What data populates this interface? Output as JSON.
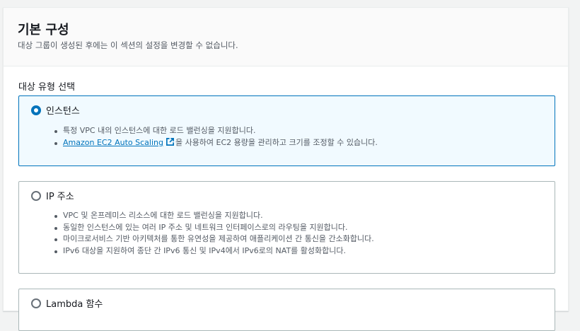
{
  "section": {
    "title": "기본 구성",
    "description": "대상 그룹이 생성된 후에는 이 섹션의 설정을 변경할 수 없습니다."
  },
  "target_type": {
    "label": "대상 유형 선택",
    "options": [
      {
        "label": "인스턴스",
        "selected": true,
        "bullets": [
          "특정 VPC 내의 인스턴스에 대한 로드 밸런싱을 지원합니다."
        ],
        "link_text": "Amazon EC2 Auto Scaling",
        "link_suffix": "을 사용하여 EC2 용량을 관리하고 크기를 조정할 수 있습니다."
      },
      {
        "label": "IP 주소",
        "selected": false,
        "bullets": [
          "VPC 및 온프레미스 리소스에 대한 로드 밸런싱을 지원합니다.",
          "동일한 인스턴스에 있는 여러 IP 주소 및 네트워크 인터페이스로의 라우팅을 지원합니다.",
          "마이크로서비스 기반 아키텍처를 통한 유연성을 제공하여 애플리케이션 간 통신을 간소화합니다.",
          "IPv6 대상을 지원하여 종단 간 IPv6 통신 및 IPv4에서 IPv6로의 NAT를 활성화합니다."
        ]
      },
      {
        "label": "Lambda 함수",
        "selected": false
      }
    ]
  },
  "colors": {
    "accent": "#0073bb",
    "selected_bg": "#f1faff",
    "border": "#aab7b8"
  },
  "icons": {
    "external_link": "external-link-icon"
  }
}
